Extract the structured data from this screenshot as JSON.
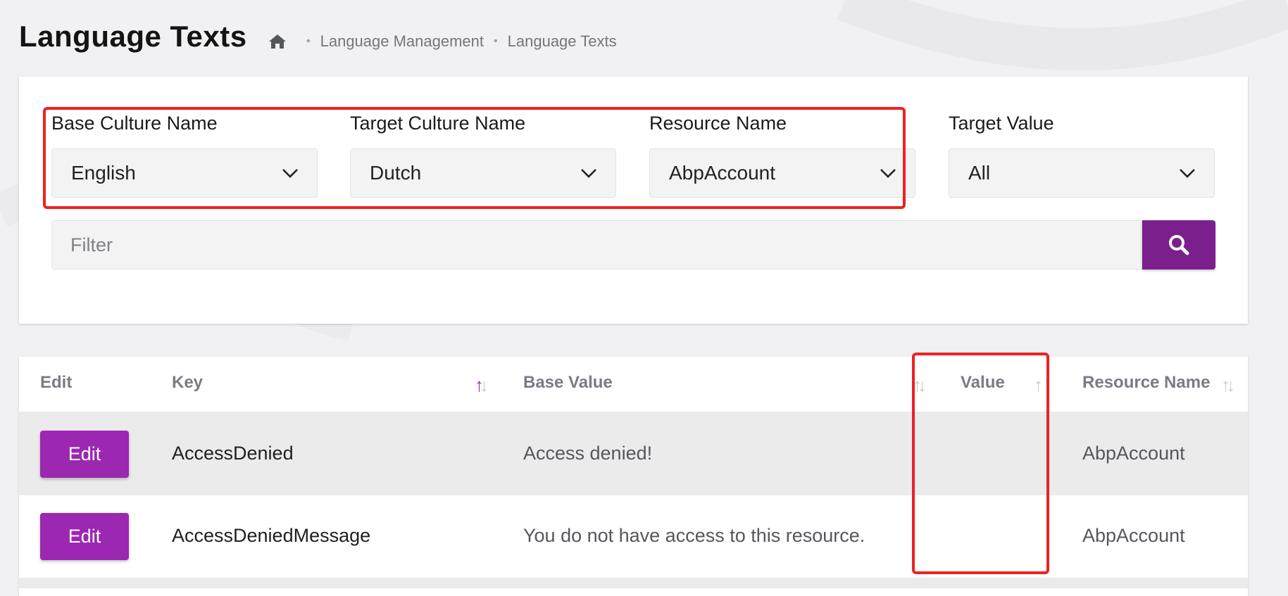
{
  "header": {
    "title": "Language Texts",
    "breadcrumb": [
      "Language Management",
      "Language Texts"
    ]
  },
  "filters": {
    "base_culture": {
      "label": "Base Culture Name",
      "value": "English"
    },
    "target_culture": {
      "label": "Target Culture Name",
      "value": "Dutch"
    },
    "resource_name": {
      "label": "Resource Name",
      "value": "AbpAccount"
    },
    "target_value": {
      "label": "Target Value",
      "value": "All"
    },
    "filter_placeholder": "Filter"
  },
  "table": {
    "columns": [
      "Edit",
      "Key",
      "Base Value",
      "Value",
      "Resource Name"
    ],
    "rows": [
      {
        "edit": "Edit",
        "key": "AccessDenied",
        "base_value": "Access denied!",
        "value": "",
        "resource": "AbpAccount"
      },
      {
        "edit": "Edit",
        "key": "AccessDeniedMessage",
        "base_value": "You do not have access to this resource.",
        "value": "",
        "resource": "AbpAccount"
      }
    ]
  },
  "colors": {
    "accent": "#9c27b0",
    "search_button": "#7a1f8b",
    "annotation": "#ee2222"
  },
  "icons": [
    "home-icon",
    "chevron-down-icon",
    "search-icon",
    "sort-icon"
  ]
}
